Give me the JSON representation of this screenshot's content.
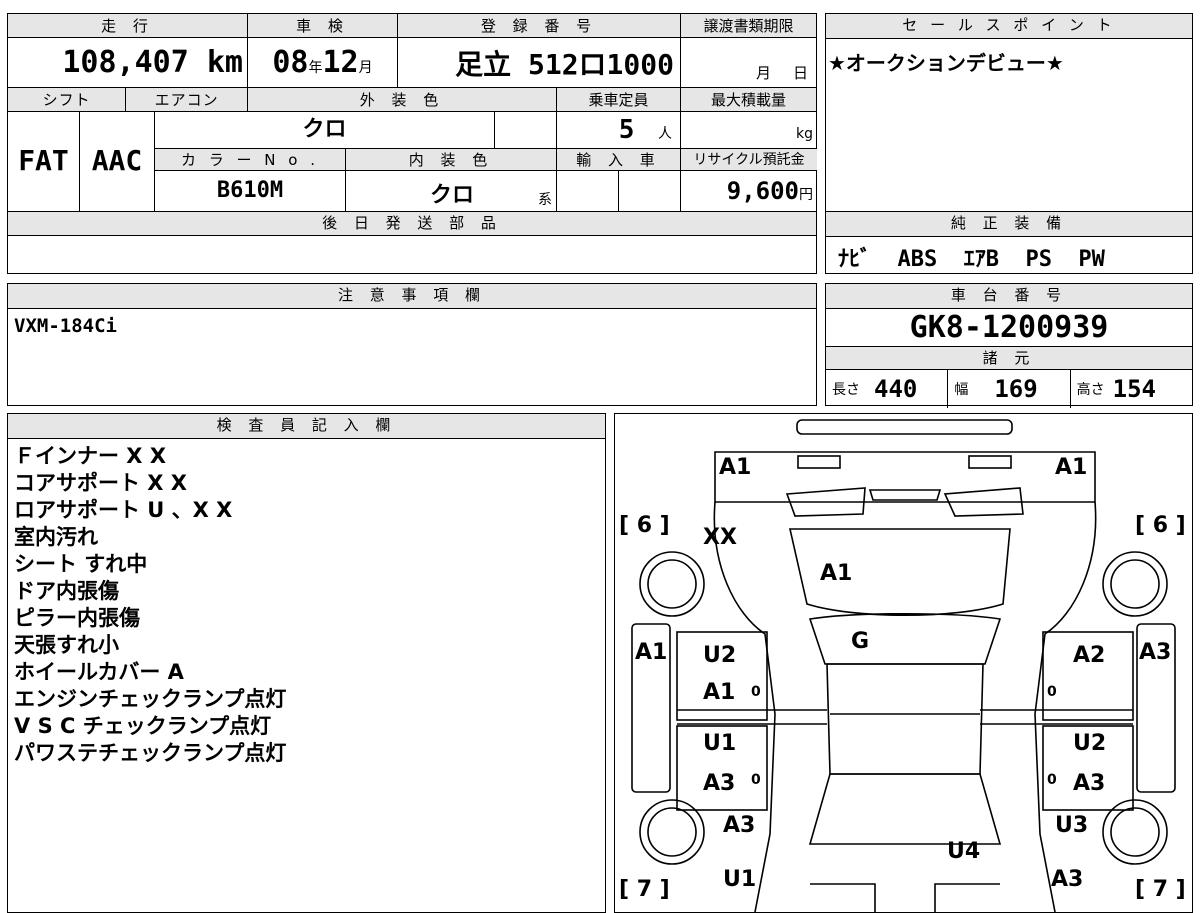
{
  "top": {
    "mileage_label": "走 行",
    "mileage_value": "108,407",
    "mileage_unit": "km",
    "inspection_label": "車 検",
    "inspection_year": "08",
    "inspection_year_unit": "年",
    "inspection_month": "12",
    "inspection_month_unit": "月",
    "registration_label": "登 録 番 号",
    "registration_value": "足立 512ロ1000",
    "transfer_label": "譲渡書類期限",
    "transfer_month_unit": "月",
    "transfer_day_unit": "日"
  },
  "row2": {
    "shift_label": "シフト",
    "shift_value": "FAT",
    "ac_label": "エアコン",
    "ac_value": "AAC",
    "exterior_color_label": "外 装 色",
    "exterior_color_value": "クロ",
    "capacity_label": "乗車定員",
    "capacity_value": "5",
    "capacity_unit": "人",
    "max_load_label": "最大積載量",
    "max_load_unit": "kg",
    "color_no_label": "カ ラ ー N o .",
    "color_no_value": "B610M",
    "interior_color_label": "内 装 色",
    "interior_color_value": "クロ",
    "interior_color_suffix": "系",
    "import_label": "輸 入 車",
    "recycle_label": "リサイクル預託金",
    "recycle_value": "9,600",
    "recycle_unit": "円"
  },
  "later_parts": {
    "label": "後 日 発 送 部 品"
  },
  "sales_point": {
    "label": "セ ー ル ス ポ イ ン ト",
    "text": "★オークションデビュー★"
  },
  "equipment": {
    "label": "純 正 装 備",
    "text": "ﾅﾋﾞ  ABS  ｴｱB  PS  PW"
  },
  "caution": {
    "label": "注 意 事 項 欄",
    "text": "VXM-184Ci"
  },
  "chassis": {
    "label": "車 台 番 号",
    "value": "GK8-1200939"
  },
  "specs": {
    "label": "諸 元",
    "length_label": "長さ",
    "length_value": "440",
    "width_label": "幅",
    "width_value": "169",
    "height_label": "高さ",
    "height_value": "154"
  },
  "inspector": {
    "label": "検 査 員 記 入 欄",
    "notes": [
      "Ｆインナー X X",
      "コアサポート X X",
      "ロアサポート U 、X X",
      "室内汚れ",
      "シート すれ中",
      "ドア内張傷",
      "ピラー内張傷",
      "天張すれ小",
      "ホイールカバー A",
      "エンジンチェックランプ点灯",
      "V S C チェックランプ点灯",
      "パワステチェックランプ点灯"
    ]
  },
  "diagram": {
    "bracket_left_top": "[ 6 ]",
    "bracket_right_top": "[ 6 ]",
    "bracket_left_bottom": "[ 7 ]",
    "bracket_right_bottom": "[ 7 ]",
    "marks": {
      "front_left": "A1",
      "front_right": "A1",
      "fender_left": "XX",
      "hood": "A1",
      "windshield": "G",
      "left_pillar": "A1",
      "right_pillar": "A3",
      "front_left_door_top": "U2",
      "front_left_door_bottom": "A1",
      "front_right_door_top": "A2",
      "rear_left_door_top": "U1",
      "rear_left_door_bottom": "A3",
      "rear_right_door_top": "U2",
      "rear_right_door_bottom": "A3",
      "rear_left_quarter": "A3",
      "rear_right_quarter": "U3",
      "roof_rear": "U4",
      "rear_left": "U1",
      "rear_right": "A3",
      "door_handle": "0"
    }
  }
}
